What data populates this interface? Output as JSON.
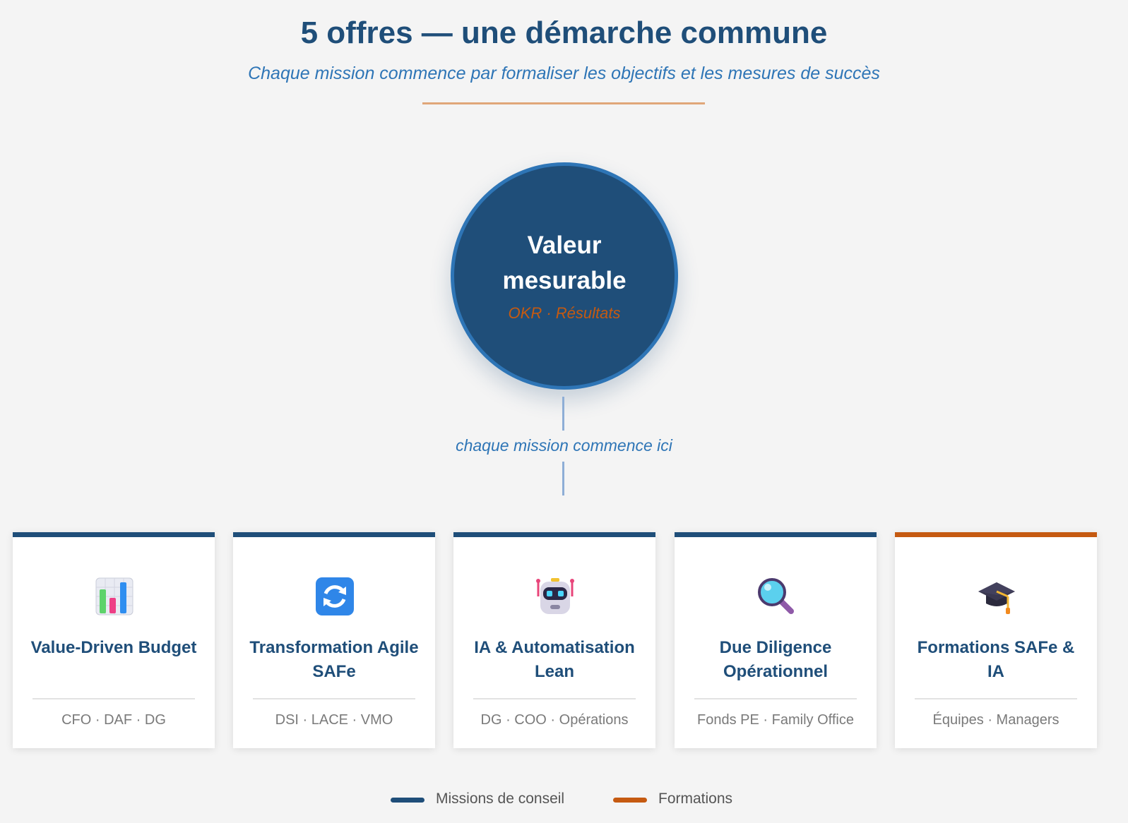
{
  "header": {
    "title": "5 offres — une démarche commune",
    "subtitle": "Chaque mission commence par formaliser les objectifs et les mesures de succès"
  },
  "hub": {
    "title": "Valeur mesurable",
    "subtitle": "OKR · Résultats"
  },
  "connector": {
    "label": "chaque mission commence ici"
  },
  "offers": [
    {
      "title": "Value-Driven Budget",
      "audience": "CFO · DAF · DG",
      "icon": "bar-chart-icon",
      "category": "conseil"
    },
    {
      "title": "Transformation Agile SAFe",
      "audience": "DSI · LACE · VMO",
      "icon": "refresh-arrows-icon",
      "category": "conseil"
    },
    {
      "title": "IA & Automatisation Lean",
      "audience": "DG · COO · Opérations",
      "icon": "robot-icon",
      "category": "conseil"
    },
    {
      "title": "Due Diligence Opérationnel",
      "audience": "Fonds PE · Family Office",
      "icon": "magnifying-glass-icon",
      "category": "conseil"
    },
    {
      "title": "Formations SAFe & IA",
      "audience": "Équipes · Managers",
      "icon": "graduation-cap-icon",
      "category": "formation"
    }
  ],
  "legend": {
    "consulting": {
      "label": "Missions de conseil",
      "color": "#1f4e79"
    },
    "training": {
      "label": "Formations",
      "color": "#c55a11"
    }
  },
  "colors": {
    "primary": "#1f4e79",
    "accent": "#c55a11",
    "link_blue": "#2e75b6",
    "background": "#f4f4f4"
  }
}
